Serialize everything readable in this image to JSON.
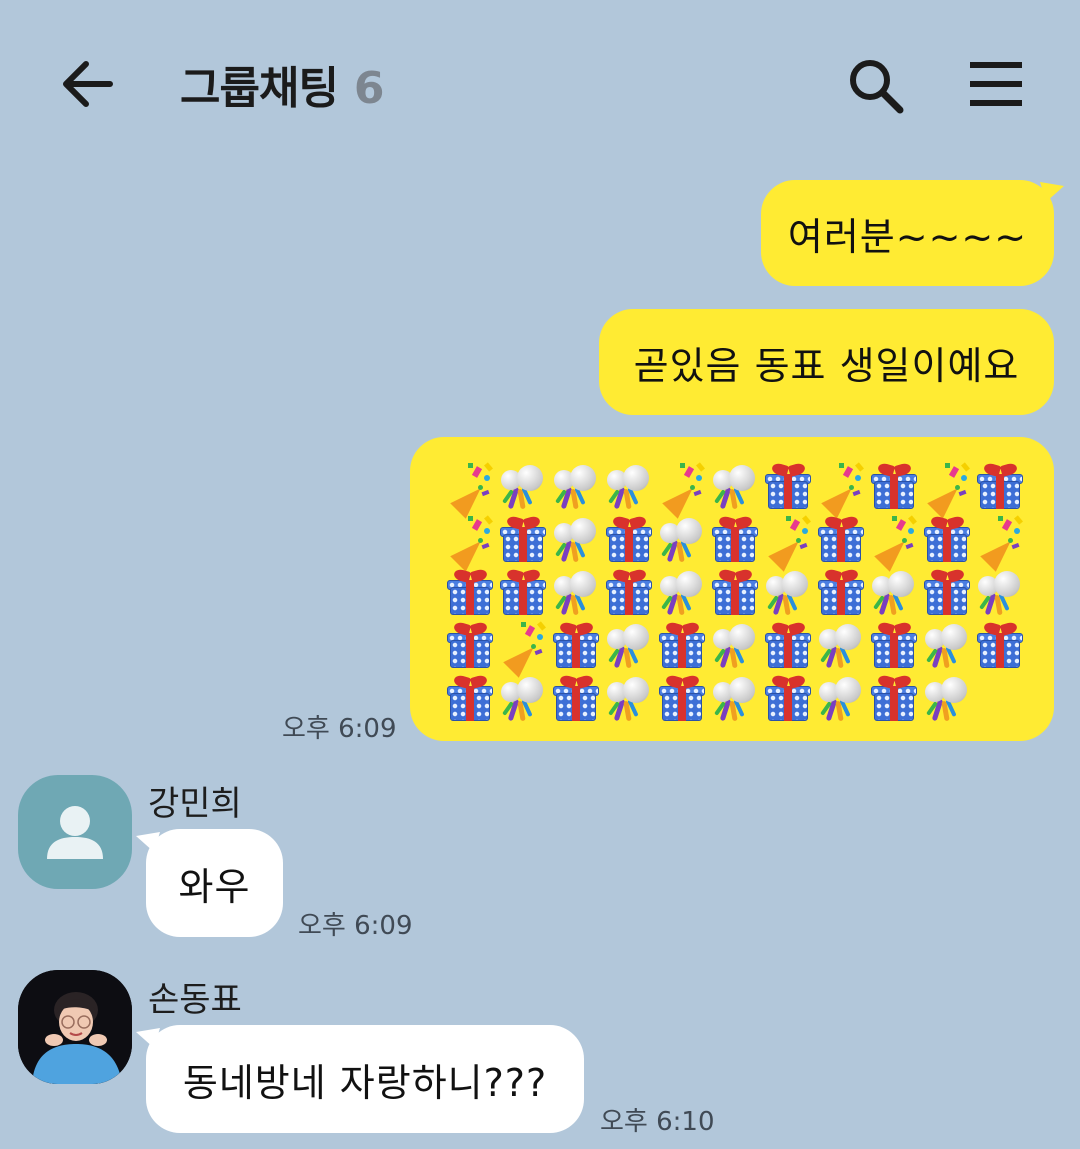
{
  "header": {
    "title": "그룹채팅",
    "member_count": "6",
    "back_icon": "arrow-left-icon",
    "search_icon": "search-icon",
    "menu_icon": "hamburger-menu-icon"
  },
  "colors": {
    "background": "#b2c7da",
    "my_bubble": "#ffeb33",
    "other_bubble": "#ffffff"
  },
  "messages": {
    "mine": [
      {
        "text": "여러분~~~~"
      },
      {
        "text": "곧있음 동표 생일이예요"
      }
    ],
    "emoji_grid": [
      [
        "party-popper",
        "confetti-ball",
        "confetti-ball",
        "confetti-ball",
        "party-popper",
        "confetti-ball",
        "wrapped-gift",
        "party-popper",
        "wrapped-gift",
        "party-popper",
        "wrapped-gift"
      ],
      [
        "party-popper",
        "wrapped-gift",
        "confetti-ball",
        "wrapped-gift",
        "confetti-ball",
        "wrapped-gift",
        "party-popper",
        "wrapped-gift",
        "party-popper",
        "wrapped-gift",
        "party-popper"
      ],
      [
        "wrapped-gift",
        "wrapped-gift",
        "confetti-ball",
        "wrapped-gift",
        "confetti-ball",
        "wrapped-gift",
        "confetti-ball",
        "wrapped-gift",
        "confetti-ball",
        "wrapped-gift",
        "confetti-ball"
      ],
      [
        "wrapped-gift",
        "party-popper",
        "wrapped-gift",
        "confetti-ball",
        "wrapped-gift",
        "confetti-ball",
        "wrapped-gift",
        "confetti-ball",
        "wrapped-gift",
        "confetti-ball",
        "wrapped-gift"
      ],
      [
        "wrapped-gift",
        "confetti-ball",
        "wrapped-gift",
        "confetti-ball",
        "wrapped-gift",
        "confetti-ball",
        "wrapped-gift",
        "confetti-ball",
        "wrapped-gift",
        "confetti-ball"
      ]
    ],
    "mine_time": "오후 6:09",
    "other1": {
      "sender": "강민희",
      "text": "와우",
      "time": "오후 6:09"
    },
    "other2": {
      "sender": "손동표",
      "text": "동네방네 자랑하니???",
      "time": "오후 6:10"
    }
  }
}
